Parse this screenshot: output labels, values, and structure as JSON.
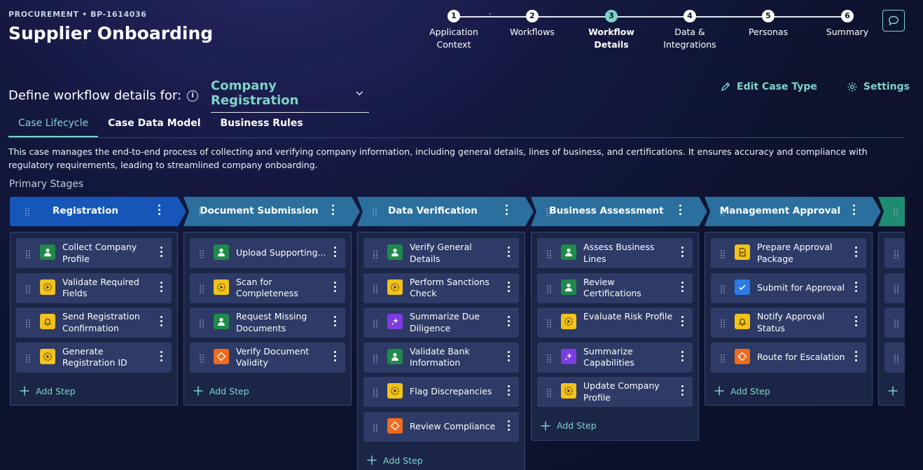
{
  "header": {
    "breadcrumb": "PROCUREMENT • BP-1614036",
    "title": "Supplier Onboarding"
  },
  "stepper": [
    {
      "num": "1",
      "label": "Application Context"
    },
    {
      "num": "2",
      "label": "Workflows"
    },
    {
      "num": "3",
      "label": "Workflow Details",
      "active": true
    },
    {
      "num": "4",
      "label": "Data & Integrations"
    },
    {
      "num": "5",
      "label": "Personas"
    },
    {
      "num": "6",
      "label": "Summary"
    }
  ],
  "define": {
    "label": "Define workflow details for:",
    "case_type": "Company Registration"
  },
  "actions": {
    "edit": "Edit Case Type",
    "settings": "Settings"
  },
  "tabs": [
    {
      "label": "Case Lifecycle",
      "active": true
    },
    {
      "label": "Case Data Model"
    },
    {
      "label": "Business Rules"
    }
  ],
  "description": "This case manages the end-to-end process of collecting and verifying company information, including general details, lines of business, and certifications. It ensures accuracy and compliance with regulatory requirements, leading to streamlined company onboarding.",
  "section_label": "Primary Stages",
  "add_step_label": "Add Step",
  "colors": {
    "accent": "#7fd3c8",
    "stage_first": "#1556b8",
    "stage": "#2a6f9e",
    "stage_next": "#1e8c70"
  },
  "stages": [
    {
      "title": "Registration",
      "steps": [
        {
          "name": "Collect Company Profile",
          "icon": "user-icon"
        },
        {
          "name": "Validate Required Fields",
          "icon": "gear-icon"
        },
        {
          "name": "Send Registration Confirmation",
          "icon": "bell-icon"
        },
        {
          "name": "Generate Registration ID",
          "icon": "gear-icon"
        }
      ]
    },
    {
      "title": "Document Submission",
      "steps": [
        {
          "name": "Upload Supporting...",
          "icon": "user-icon"
        },
        {
          "name": "Scan for Completeness",
          "icon": "gear-icon"
        },
        {
          "name": "Request Missing Documents",
          "icon": "user-icon"
        },
        {
          "name": "Verify Document Validity",
          "icon": "decision-icon"
        }
      ]
    },
    {
      "title": "Data Verification",
      "steps": [
        {
          "name": "Verify General Details",
          "icon": "user-icon"
        },
        {
          "name": "Perform Sanctions Check",
          "icon": "gear-icon"
        },
        {
          "name": "Summarize Due Diligence",
          "icon": "ai-sparkle-icon"
        },
        {
          "name": "Validate Bank Information",
          "icon": "user-icon"
        },
        {
          "name": "Flag Discrepancies",
          "icon": "gear-icon"
        },
        {
          "name": "Review Compliance",
          "icon": "decision-icon"
        }
      ]
    },
    {
      "title": "Business Assessment",
      "steps": [
        {
          "name": "Assess Business Lines",
          "icon": "user-icon"
        },
        {
          "name": "Review Certifications",
          "icon": "user-icon"
        },
        {
          "name": "Evaluate Risk Profile",
          "icon": "gear-icon"
        },
        {
          "name": "Summarize Capabilities",
          "icon": "ai-sparkle-icon"
        },
        {
          "name": "Update Company Profile",
          "icon": "gear-icon"
        }
      ]
    },
    {
      "title": "Management Approval",
      "steps": [
        {
          "name": "Prepare Approval Package",
          "icon": "document-icon"
        },
        {
          "name": "Submit for Approval",
          "icon": "check-icon"
        },
        {
          "name": "Notify Approval Status",
          "icon": "bell-icon"
        },
        {
          "name": "Route for Escalation",
          "icon": "decision-icon"
        }
      ]
    }
  ]
}
